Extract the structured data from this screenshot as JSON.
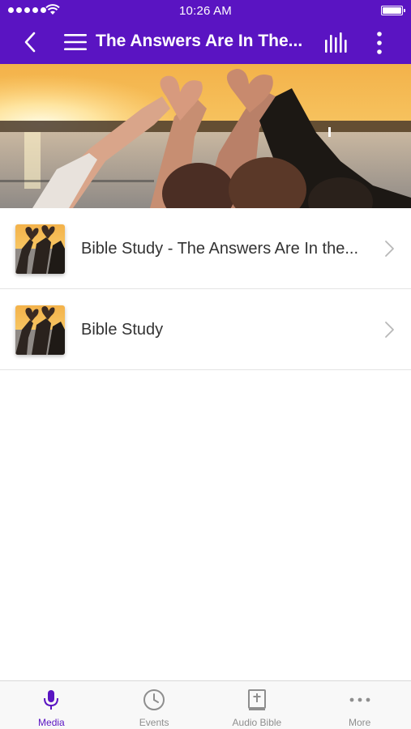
{
  "status_bar": {
    "time": "10:26 AM"
  },
  "nav": {
    "title": "The Answers Are In The...",
    "icons": [
      "back-chevron-icon",
      "hamburger-menu-icon",
      "audio-bars-icon",
      "more-vertical-icon"
    ]
  },
  "banner": {
    "image": "sunset-hands-heart-photo"
  },
  "list": {
    "items": [
      {
        "label": "Bible Study - The Answers Are In the...",
        "icon": "chevron-right-icon"
      },
      {
        "label": "Bible Study",
        "icon": "chevron-right-icon"
      }
    ]
  },
  "tabbar": {
    "active": "Media",
    "items": [
      {
        "label": "Media",
        "icon": "microphone-icon"
      },
      {
        "label": "Events",
        "icon": "clock-icon"
      },
      {
        "label": "Audio Bible",
        "icon": "bible-icon"
      },
      {
        "label": "More",
        "icon": "more-horizontal-icon"
      }
    ]
  },
  "colors": {
    "primary": "#5a14c2",
    "tab_inactive": "#8e8e8e",
    "text": "#333333"
  }
}
